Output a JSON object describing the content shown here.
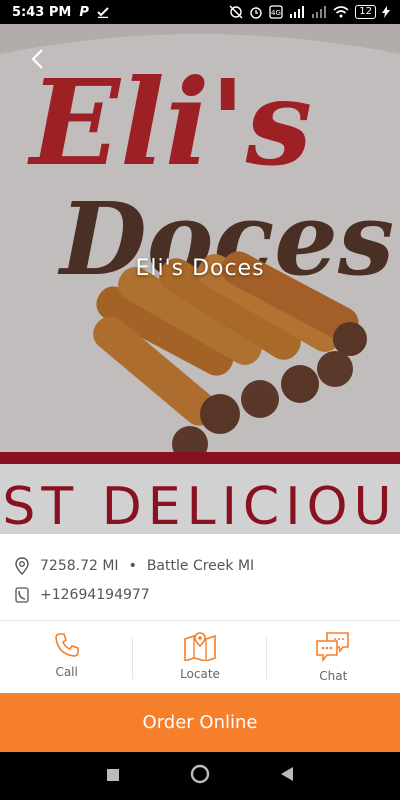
{
  "status_bar": {
    "time": "5:43 PM",
    "carrier_icon": "P",
    "battery": "12"
  },
  "hero": {
    "title": "Eli's Doces",
    "image_description_icon": "churros-logo-image",
    "image_text": {
      "line1": "Eli's",
      "line2": "Doces",
      "banner": "ST DELICIOU"
    }
  },
  "info": {
    "distance": "7258.72 MI",
    "separator": "•",
    "location": "Battle Creek MI",
    "phone": "+12694194977"
  },
  "actions": [
    {
      "label": "Call",
      "icon": "phone-icon"
    },
    {
      "label": "Locate",
      "icon": "map-icon"
    },
    {
      "label": "Chat",
      "icon": "chat-icon"
    }
  ],
  "order_button": {
    "label": "Order Online"
  },
  "colors": {
    "accent": "#f57f2a",
    "banner_red": "#a8172a",
    "script_red": "#c0282e"
  }
}
